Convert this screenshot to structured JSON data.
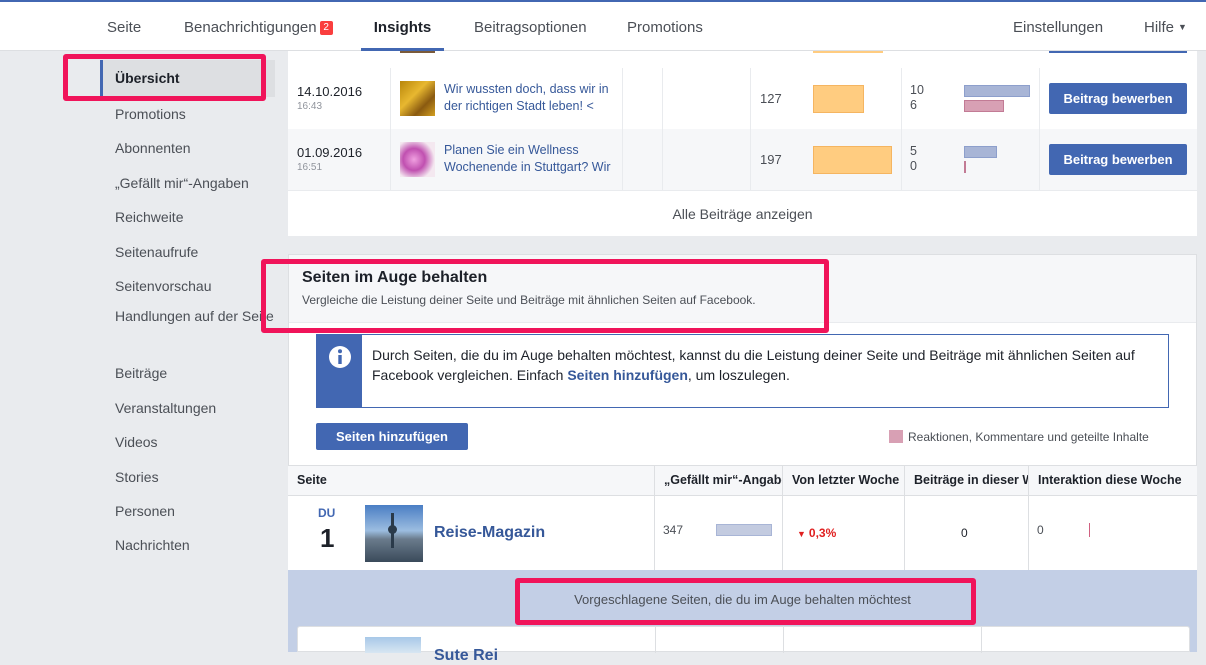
{
  "topnav": {
    "tabs": [
      "Seite",
      "Benachrichtigungen",
      "Insights",
      "Beitragsoptionen",
      "Promotions"
    ],
    "notifications_badge": "2",
    "right": [
      "Einstellungen",
      "Hilfe"
    ]
  },
  "sidebar": {
    "items": [
      "Übersicht",
      "Promotions",
      "Abonnenten",
      "„Gefällt mir“-Angaben",
      "Reichweite",
      "Seitenaufrufe",
      "Seitenvorschau",
      "Handlungen auf der Seite",
      "Beiträge",
      "Veranstaltungen",
      "Videos",
      "Stories",
      "Personen",
      "Nachrichten"
    ]
  },
  "posts": {
    "rows": [
      {
        "date": "14.10.2016",
        "time": "16:43",
        "text": "Wir wussten doch, dass wir in der richtigen Stadt leben! <",
        "reach": "127",
        "eng1": "10",
        "eng2": "6",
        "reach_fill": 0.65,
        "button": "Beitrag bewerben"
      },
      {
        "date": "01.09.2016",
        "time": "16:51",
        "text": "Planen Sie ein Wellness Wochenende in Stuttgart? Wir h",
        "reach": "197",
        "eng1": "5",
        "eng2": "0",
        "reach_fill": 1.0,
        "button": "Beitrag bewerben"
      }
    ],
    "show_all": "Alle Beiträge anzeigen"
  },
  "watch": {
    "title": "Seiten im Auge behalten",
    "subtitle": "Vergleiche die Leistung deiner Seite und Beiträge mit ähnlichen Seiten auf Facebook.",
    "info_before": "Durch Seiten, die du im Auge behalten möchtest, kannst du die Leistung deiner Seite und Beiträge mit ähnlichen Seiten auf Facebook vergleichen. Einfach ",
    "info_link": "Seiten hinzufügen",
    "info_after": ", um loszulegen.",
    "add_button": "Seiten hinzufügen",
    "legend": "Reaktionen, Kommentare und geteilte Inhalte",
    "columns": [
      "Seite",
      "„Gefällt mir“-Angaben",
      "Von letzter Woche",
      "Beiträge in dieser Woche",
      "Interaktion diese Woche"
    ],
    "row": {
      "you_label": "DU",
      "rank": "1",
      "page_name": "Reise-Magazin",
      "likes": "347",
      "change": "0,3%",
      "posts": "0",
      "engagement": "0"
    },
    "suggested": "Vorgeschlagene Seiten, die du im Auge behalten möchtest",
    "next_page_partial": "Sute Rei"
  },
  "colors": {
    "accent": "#4267b2",
    "highlight": "#f0145a",
    "orange_bar": "#ffcc80",
    "down": "#e02020"
  }
}
